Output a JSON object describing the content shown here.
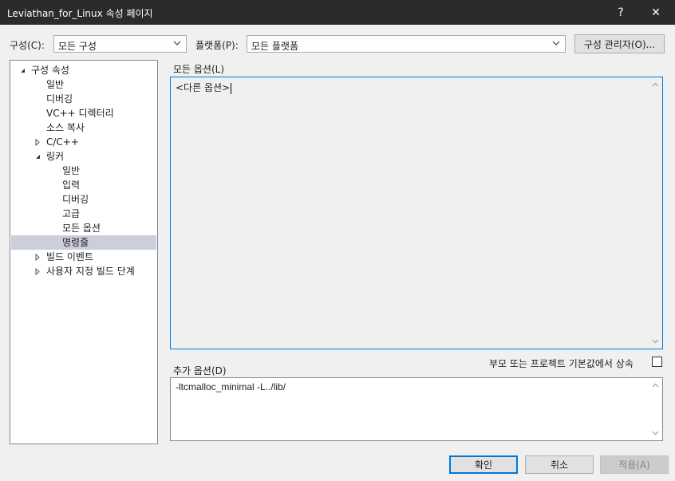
{
  "window": {
    "title": "Leviathan_for_Linux 속성 페이지",
    "help_label": "?",
    "close_label": "✕"
  },
  "toolbar": {
    "config_label": "구성(C):",
    "config_value": "모든 구성",
    "platform_label": "플랫폼(P):",
    "platform_value": "모든 플랫폼",
    "config_manager_label": "구성 관리자(O)..."
  },
  "tree": {
    "items": [
      {
        "label": "구성 속성",
        "level": 0,
        "expanded": true,
        "has_children": true,
        "selected": false
      },
      {
        "label": "일반",
        "level": 1,
        "has_children": false,
        "selected": false
      },
      {
        "label": "디버깅",
        "level": 1,
        "has_children": false,
        "selected": false
      },
      {
        "label": "VC++ 디렉터리",
        "level": 1,
        "has_children": false,
        "selected": false
      },
      {
        "label": "소스 복사",
        "level": 1,
        "has_children": false,
        "selected": false
      },
      {
        "label": "C/C++",
        "level": 1,
        "expanded": false,
        "has_children": true,
        "selected": false
      },
      {
        "label": "링커",
        "level": 1,
        "expanded": true,
        "has_children": true,
        "selected": false
      },
      {
        "label": "일반",
        "level": 2,
        "has_children": false,
        "selected": false
      },
      {
        "label": "입력",
        "level": 2,
        "has_children": false,
        "selected": false
      },
      {
        "label": "디버깅",
        "level": 2,
        "has_children": false,
        "selected": false
      },
      {
        "label": "고급",
        "level": 2,
        "has_children": false,
        "selected": false
      },
      {
        "label": "모든 옵션",
        "level": 2,
        "has_children": false,
        "selected": false
      },
      {
        "label": "명령줄",
        "level": 2,
        "has_children": false,
        "selected": true
      },
      {
        "label": "빌드 이벤트",
        "level": 1,
        "expanded": false,
        "has_children": true,
        "selected": false
      },
      {
        "label": "사용자 지정 빌드 단계",
        "level": 1,
        "expanded": false,
        "has_children": true,
        "selected": false
      }
    ]
  },
  "all_options": {
    "label": "모든 옵션(L)",
    "value": "<다른 옵션>"
  },
  "inherit": {
    "label": "부모 또는 프로젝트 기본값에서 상속",
    "checked": false
  },
  "additional_options": {
    "label": "추가 옵션(D)",
    "value": "-ltcmalloc_minimal -L../lib/"
  },
  "footer": {
    "ok_label": "확인",
    "cancel_label": "취소",
    "apply_label": "적용(A)"
  },
  "colors": {
    "titlebar": "#2b2b2b",
    "focus_border": "#0078d7",
    "selection": "#cccedb"
  }
}
